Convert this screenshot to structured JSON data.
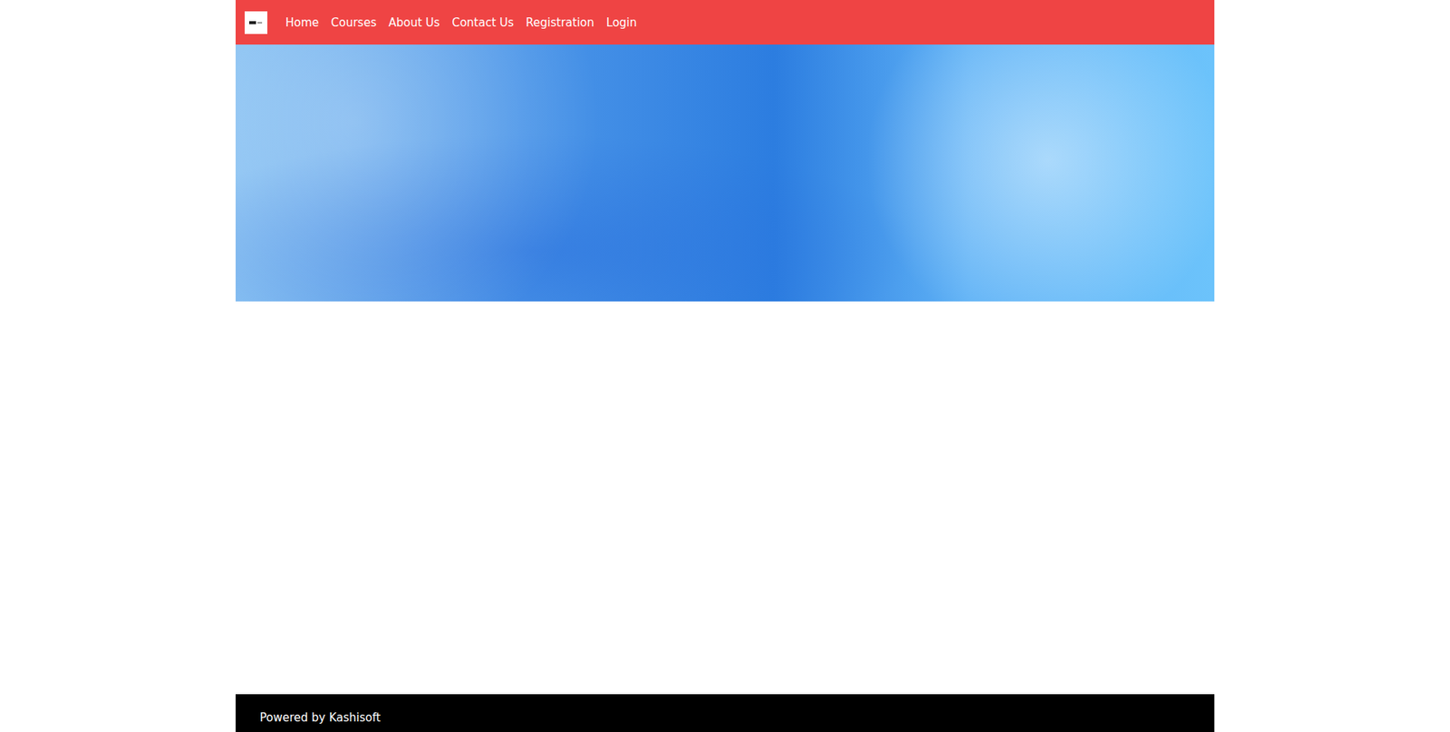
{
  "nav": {
    "items": [
      "Home",
      "Courses",
      "About Us",
      "Contact Us",
      "Registration",
      "Login"
    ]
  },
  "footer": {
    "text": "Powered by Kashisoft"
  }
}
